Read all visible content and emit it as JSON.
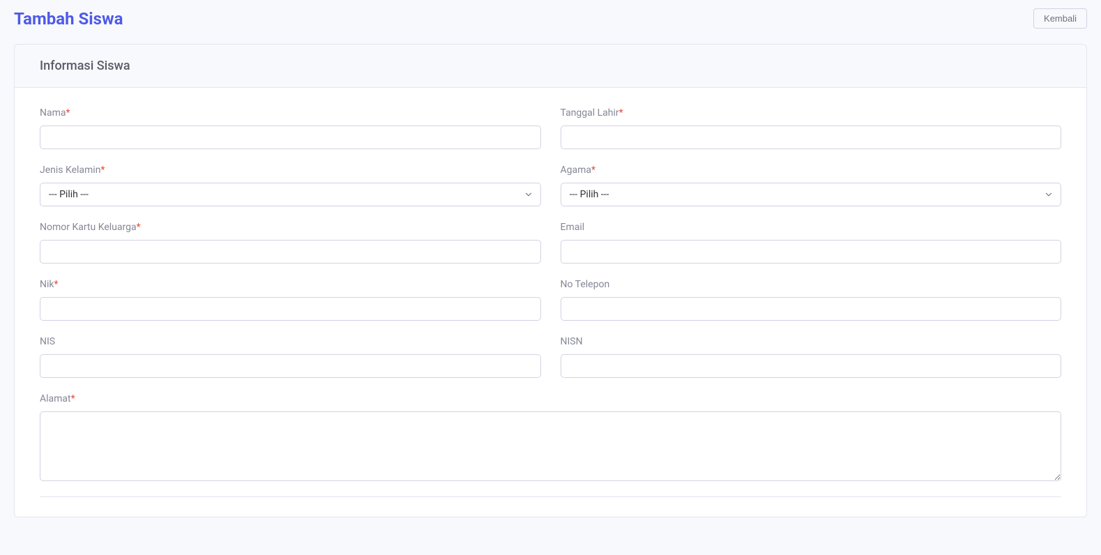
{
  "header": {
    "title": "Tambah Siswa",
    "back_button": "Kembali"
  },
  "card": {
    "title": "Informasi Siswa"
  },
  "form": {
    "nama": {
      "label": "Nama",
      "required": "*"
    },
    "tanggal_lahir": {
      "label": "Tanggal Lahir",
      "required": "*"
    },
    "jenis_kelamin": {
      "label": "Jenis Kelamin",
      "required": "*",
      "placeholder": "--- Pilih ---"
    },
    "agama": {
      "label": "Agama",
      "required": "*",
      "placeholder": "--- Pilih ---"
    },
    "nomor_kk": {
      "label": "Nomor Kartu Keluarga",
      "required": "*"
    },
    "email": {
      "label": "Email"
    },
    "nik": {
      "label": "Nik",
      "required": "*"
    },
    "no_telepon": {
      "label": "No Telepon"
    },
    "nis": {
      "label": "NIS"
    },
    "nisn": {
      "label": "NISN"
    },
    "alamat": {
      "label": "Alamat",
      "required": "*"
    }
  }
}
